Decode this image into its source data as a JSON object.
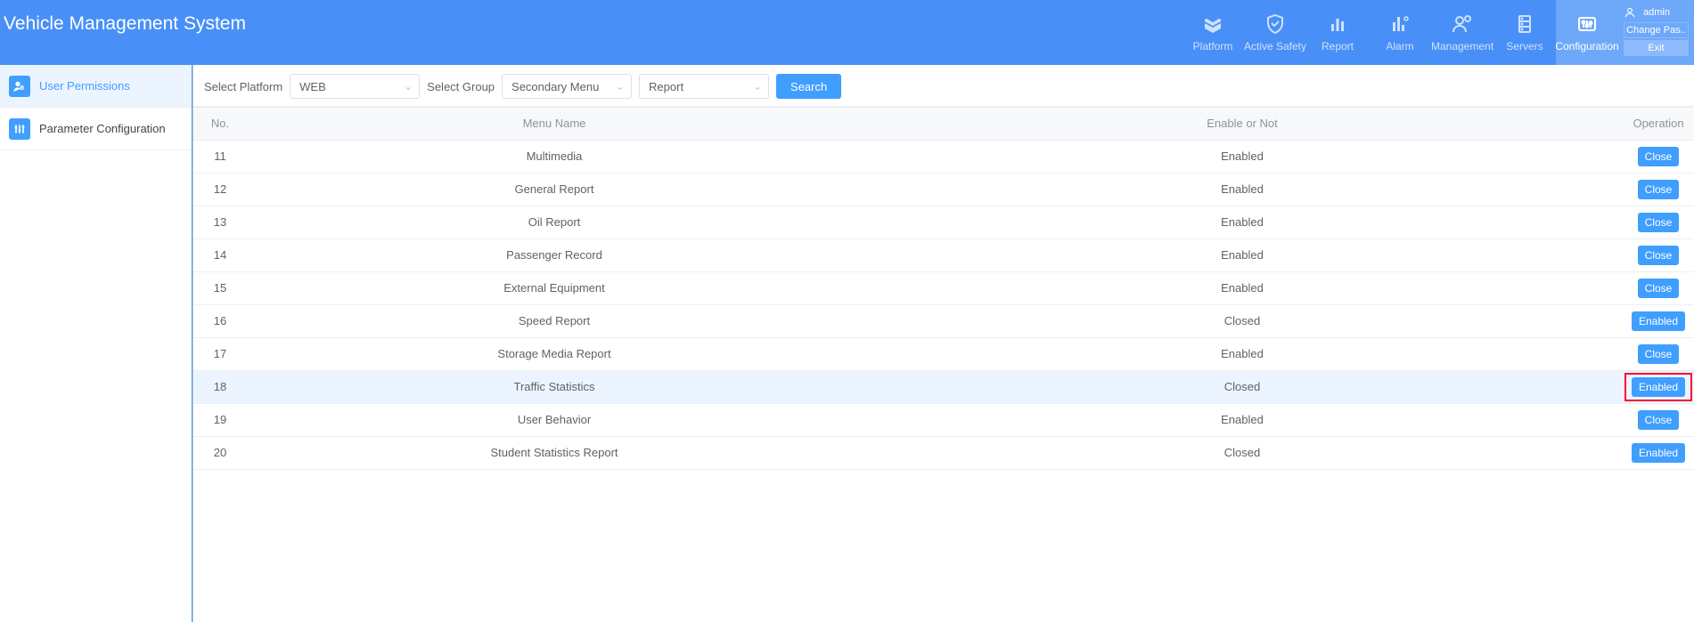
{
  "header": {
    "title": "Vehicle Management System",
    "nav": [
      {
        "id": "platform",
        "label": "Platform"
      },
      {
        "id": "active-safety",
        "label": "Active Safety"
      },
      {
        "id": "report",
        "label": "Report"
      },
      {
        "id": "alarm",
        "label": "Alarm"
      },
      {
        "id": "management",
        "label": "Management"
      },
      {
        "id": "servers",
        "label": "Servers"
      },
      {
        "id": "configuration",
        "label": "Configuration",
        "active": true
      }
    ],
    "user": {
      "name": "admin",
      "changepass": "Change Pas..",
      "exit": "Exit"
    }
  },
  "sidebar": {
    "items": [
      {
        "id": "user-permissions",
        "label": "User Permissions",
        "active": true
      },
      {
        "id": "parameter-configuration",
        "label": "Parameter Configuration"
      }
    ]
  },
  "filters": {
    "platformLabel": "Select Platform",
    "platformValue": "WEB",
    "groupLabel": "Select Group",
    "groupValue": "Secondary Menu",
    "thirdValue": "Report",
    "searchLabel": "Search"
  },
  "table": {
    "headers": {
      "no": "No.",
      "menu": "Menu Name",
      "enable": "Enable or Not",
      "op": "Operation"
    },
    "rows": [
      {
        "no": "11",
        "menu": "Multimedia",
        "enable": "Enabled",
        "op": "Close"
      },
      {
        "no": "12",
        "menu": "General Report",
        "enable": "Enabled",
        "op": "Close"
      },
      {
        "no": "13",
        "menu": "Oil Report",
        "enable": "Enabled",
        "op": "Close"
      },
      {
        "no": "14",
        "menu": "Passenger Record",
        "enable": "Enabled",
        "op": "Close"
      },
      {
        "no": "15",
        "menu": "External Equipment",
        "enable": "Enabled",
        "op": "Close"
      },
      {
        "no": "16",
        "menu": "Speed Report",
        "enable": "Closed",
        "op": "Enabled"
      },
      {
        "no": "17",
        "menu": "Storage Media Report",
        "enable": "Enabled",
        "op": "Close"
      },
      {
        "no": "18",
        "menu": "Traffic Statistics",
        "enable": "Closed",
        "op": "Enabled",
        "hover": true,
        "highlight": true
      },
      {
        "no": "19",
        "menu": "User Behavior",
        "enable": "Enabled",
        "op": "Close"
      },
      {
        "no": "20",
        "menu": "Student Statistics Report",
        "enable": "Closed",
        "op": "Enabled"
      }
    ]
  }
}
